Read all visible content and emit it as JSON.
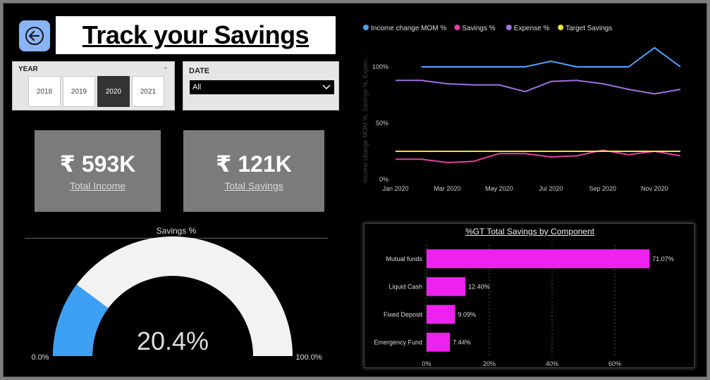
{
  "header": {
    "title": "Track your Savings"
  },
  "year_slicer": {
    "label": "YEAR",
    "options": [
      "2018",
      "2019",
      "2020",
      "2021"
    ],
    "selected": "2020"
  },
  "date_slicer": {
    "label": "DATE",
    "value": "All"
  },
  "cards": {
    "income": {
      "value": "₹ 593K",
      "label": "Total Income"
    },
    "savings": {
      "value": "₹ 121K",
      "label": "Total Savings"
    }
  },
  "colors": {
    "income_change": "#4da3ff",
    "savings": "#e040a0",
    "expense": "#a070e0",
    "target": "#f0e040",
    "gauge_fill": "#3da0f5",
    "gauge_track": "#f2f2f2",
    "bars": "#ee22ee"
  },
  "chart_data": [
    {
      "type": "line",
      "title": "",
      "ylabel": "Income change MOM %, Savings %, Expen...",
      "legend": "top-left",
      "x": [
        "Jan 2020",
        "Feb 2020",
        "Mar 2020",
        "Apr 2020",
        "May 2020",
        "Jun 2020",
        "Jul 2020",
        "Aug 2020",
        "Sep 2020",
        "Oct 2020",
        "Nov 2020",
        "Dec 2020"
      ],
      "x_ticks": [
        "Jan 2020",
        "Mar 2020",
        "May 2020",
        "Jul 2020",
        "Sep 2020",
        "Nov 2020"
      ],
      "y_ticks": [
        "0%",
        "50%",
        "100%"
      ],
      "ylim": [
        0,
        120
      ],
      "series": [
        {
          "name": "Income change MOM %",
          "values": [
            null,
            100,
            100,
            100,
            100,
            100,
            105,
            100,
            100,
            100,
            117,
            100
          ]
        },
        {
          "name": "Savings %",
          "values": [
            18,
            18,
            15,
            16,
            23,
            23,
            20,
            21,
            26,
            22,
            25,
            21
          ]
        },
        {
          "name": "Expense %",
          "values": [
            88,
            88,
            85,
            84,
            84,
            78,
            87,
            88,
            85,
            80,
            76,
            80
          ]
        },
        {
          "name": "Target Savings",
          "values": [
            25,
            25,
            25,
            25,
            25,
            25,
            25,
            25,
            25,
            25,
            25,
            25
          ]
        }
      ]
    },
    {
      "type": "gauge",
      "title": "Savings %",
      "value": 20.4,
      "value_label": "20.4%",
      "min": 0,
      "max": 100,
      "min_label": "0.0%",
      "max_label": "100.0%"
    },
    {
      "type": "bar",
      "orientation": "horizontal",
      "title": "%GT Total Savings by Component",
      "categories": [
        "Mutual funds",
        "Liquid Cash",
        "Fixed Deposit",
        "Emergency Fund"
      ],
      "values": [
        71.07,
        12.4,
        9.09,
        7.44
      ],
      "value_labels": [
        "71.07%",
        "12.40%",
        "9.09%",
        "7.44%"
      ],
      "x_ticks": [
        "0%",
        "20%",
        "40%",
        "60%"
      ],
      "xlim": [
        0,
        80
      ],
      "grid": true
    }
  ]
}
